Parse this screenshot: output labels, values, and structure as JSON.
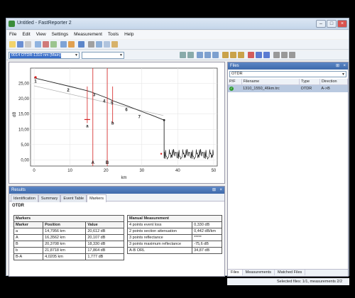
{
  "window": {
    "title": "Untitled - FastReporter 2"
  },
  "menu": [
    "File",
    "Edit",
    "View",
    "Settings",
    "Measurement",
    "Tools",
    "Help"
  ],
  "trace_selector": {
    "selected": "0014 OTDR-1310 nm (Main)"
  },
  "chart": {
    "y_ticks": [
      "25,00",
      "20,00",
      "15,00",
      "10,00",
      "5,00",
      "0,00"
    ],
    "x_ticks": [
      "0",
      "10",
      "20",
      "30",
      "40",
      "50"
    ],
    "ylabel": "dB",
    "xlabel": "km",
    "event_labels": [
      "1",
      "2",
      "3",
      "4",
      "5",
      "6",
      "7"
    ],
    "marker_labels": [
      "a",
      "A",
      "b",
      "B"
    ]
  },
  "chart_data": {
    "type": "line",
    "xlabel": "km",
    "ylabel": "dB",
    "xlim": [
      -1,
      51
    ],
    "ylim": [
      -2,
      30
    ],
    "series": [
      {
        "x": [
          0,
          5,
          10,
          14.7956,
          16.3562,
          20.3708,
          22,
          26,
          30,
          33,
          36.2
        ],
        "y": [
          26.8,
          25.4,
          24.0,
          22.6,
          22.0,
          20.2,
          19.3,
          17.6,
          15.8,
          14.5,
          13.0
        ]
      }
    ],
    "markers": [
      {
        "name": "a",
        "x": 14.7956
      },
      {
        "name": "A",
        "x": 16.3562
      },
      {
        "name": "B",
        "x": 20.3708
      },
      {
        "name": "b",
        "x": 21.8718
      }
    ]
  },
  "results": {
    "title": "Results",
    "tabs": [
      "Identification",
      "Summary",
      "Event Table",
      "Markers"
    ],
    "section": "OTDR",
    "markers_table": {
      "title": "Markers",
      "headers": [
        "Marker",
        "Position",
        "Value"
      ],
      "rows": [
        [
          "a",
          "14,7956 km",
          "20,612 dB"
        ],
        [
          "A",
          "16,3562 km",
          "20,107 dB"
        ],
        [
          "B",
          "20,3708 km",
          "18,330 dB"
        ],
        [
          "b",
          "21,8718 km",
          "17,864 dB"
        ],
        [
          "B-A",
          "4,0205 km",
          "1,777 dB"
        ]
      ]
    },
    "manual_table": {
      "title": "Manual Measurement",
      "rows": [
        [
          "4 points event loss",
          "0,330 dB"
        ],
        [
          "2 points section attenuation",
          "0,442 dB/km"
        ],
        [
          "3 points reflectance",
          "*****"
        ],
        [
          "3 points maximum reflectance",
          "-75,6 dB"
        ],
        [
          "A-B ORL",
          "34,87 dB"
        ]
      ]
    }
  },
  "files": {
    "title": "Files",
    "combo": "OTDR",
    "headers": [
      "P/F",
      "Filename",
      "Type",
      "Direction"
    ],
    "rows": [
      {
        "filename": "1310_1550_46km.trc",
        "type": "OTDR",
        "direction": "A->B"
      }
    ],
    "tabs": [
      "Files",
      "Measurements",
      "Matched Files"
    ]
  },
  "status": "Selected files: 1/1, measurements 2/2"
}
